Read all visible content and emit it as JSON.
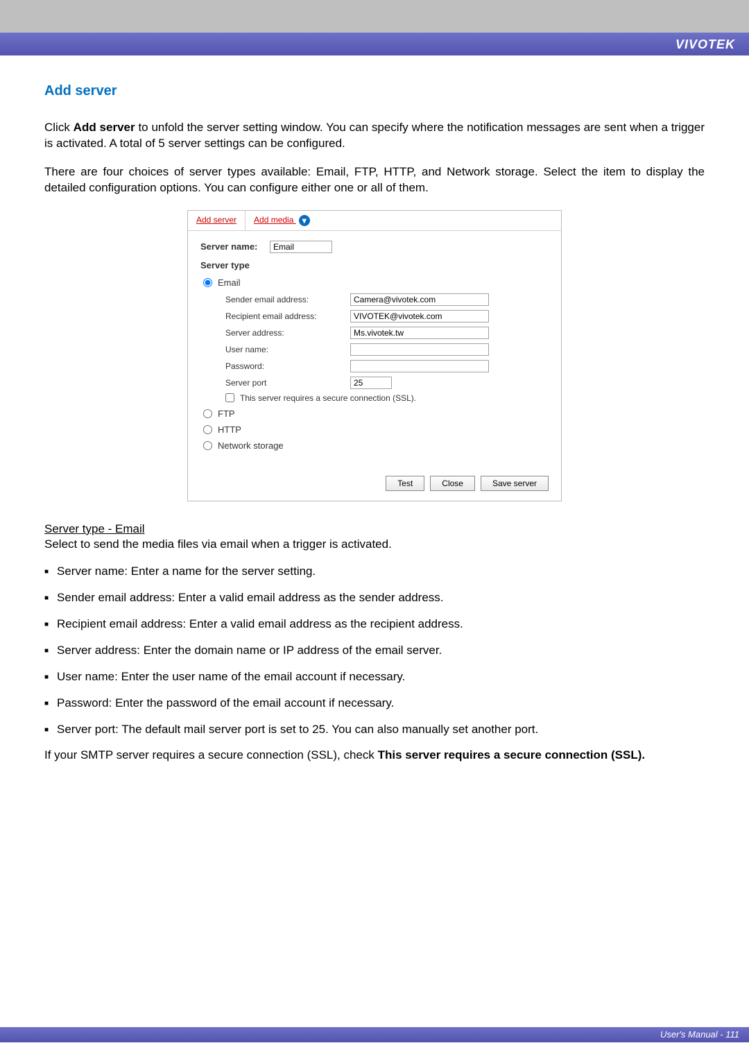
{
  "brand": "VIVOTEK",
  "section_title": "Add server",
  "intro_p1_pre": "Click ",
  "intro_p1_bold": "Add server",
  "intro_p1_post": " to unfold the server setting window. You can specify where the notification messages are sent when a trigger is activated. A total of 5 server settings can be configured.",
  "intro_p2": "There are four choices of server types available: Email, FTP, HTTP, and Network storage. Select the item to display the detailed configuration options. You can configure either one or all of them.",
  "panel": {
    "tab_add_server": "Add server",
    "tab_add_media": "Add media",
    "server_name_label": "Server name:",
    "server_name_value": "Email",
    "server_type_heading": "Server type",
    "radios": {
      "email": "Email",
      "ftp": "FTP",
      "http": "HTTP",
      "network_storage": "Network storage"
    },
    "fields": {
      "sender_label": "Sender email address:",
      "sender_value": "Camera@vivotek.com",
      "recipient_label": "Recipient email address:",
      "recipient_value": "VIVOTEK@vivotek.com",
      "server_addr_label": "Server address:",
      "server_addr_value": "Ms.vivotek.tw",
      "username_label": "User name:",
      "username_value": "",
      "password_label": "Password:",
      "password_value": "",
      "port_label": "Server port",
      "port_value": "25",
      "ssl_label": "This server requires a secure connection (SSL)."
    },
    "buttons": {
      "test": "Test",
      "close": "Close",
      "save": "Save server"
    }
  },
  "subhead": "Server type - Email",
  "subtext": "Select to send the media files via email when a trigger is activated.",
  "bullets": [
    "Server name: Enter a name for the server setting.",
    "Sender email address: Enter a valid email address as the sender address.",
    "Recipient email address: Enter a valid email address as the recipient address.",
    "Server address: Enter the domain name or IP address of the email server.",
    "User name: Enter the user name of the email account if necessary.",
    "Password: Enter the password of the email account if necessary.",
    "Server port: The default mail server port is set to 25. You can also manually set another port."
  ],
  "closing_pre": "If your SMTP server requires a secure connection (SSL), check ",
  "closing_bold": "This server requires a secure connection (SSL).",
  "footer": "User's Manual - 111"
}
